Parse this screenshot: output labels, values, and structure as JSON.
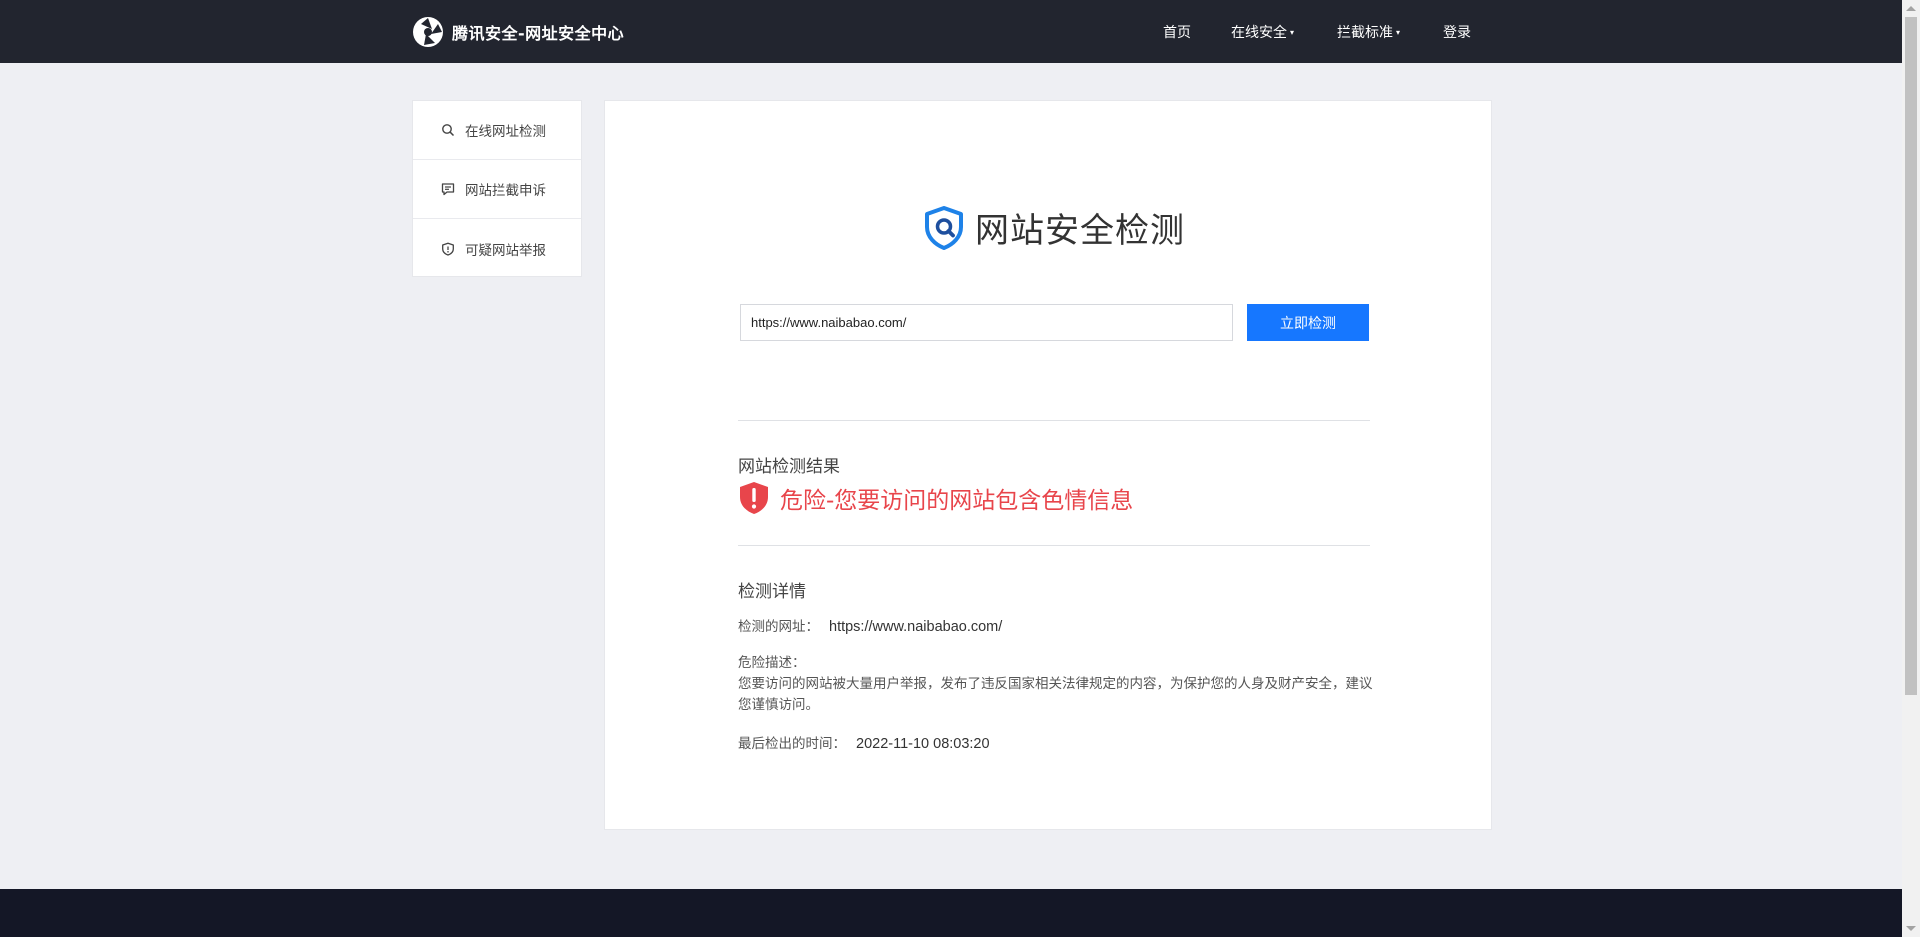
{
  "header": {
    "brand": "腾讯安全-网址安全中心",
    "nav": [
      {
        "label": "首页",
        "dropdown": false
      },
      {
        "label": "在线安全",
        "dropdown": true
      },
      {
        "label": "拦截标准",
        "dropdown": true
      },
      {
        "label": "登录",
        "dropdown": false
      }
    ],
    "caret": "▾"
  },
  "sidebar": {
    "items": [
      {
        "label": "在线网址检测",
        "icon": "search-icon"
      },
      {
        "label": "网站拦截申诉",
        "icon": "message-icon"
      },
      {
        "label": "可疑网站举报",
        "icon": "shield-icon"
      }
    ]
  },
  "main": {
    "title": "网站安全检测",
    "search": {
      "value": "https://www.naibabao.com/",
      "button": "立即检测"
    },
    "result": {
      "label": "网站检测结果",
      "status": "危险-您要访问的网站包含色情信息",
      "status_color": "#e8454b"
    },
    "details": {
      "title": "检测详情",
      "url_label": "检测的网址：",
      "url_value": "https://www.naibabao.com/",
      "desc_label": "危险描述：",
      "desc_text": "您要访问的网站被大量用户举报，发布了违反国家相关法律规定的内容，为保护您的人身及财产安全，建议您谨慎访问。",
      "time_label": "最后检出的时间：",
      "time_value": "2022-11-10 08:03:20"
    }
  },
  "colors": {
    "accent": "#1677ff",
    "header_bg": "#22252f",
    "footer_bg": "#141726",
    "danger": "#e8454b"
  }
}
